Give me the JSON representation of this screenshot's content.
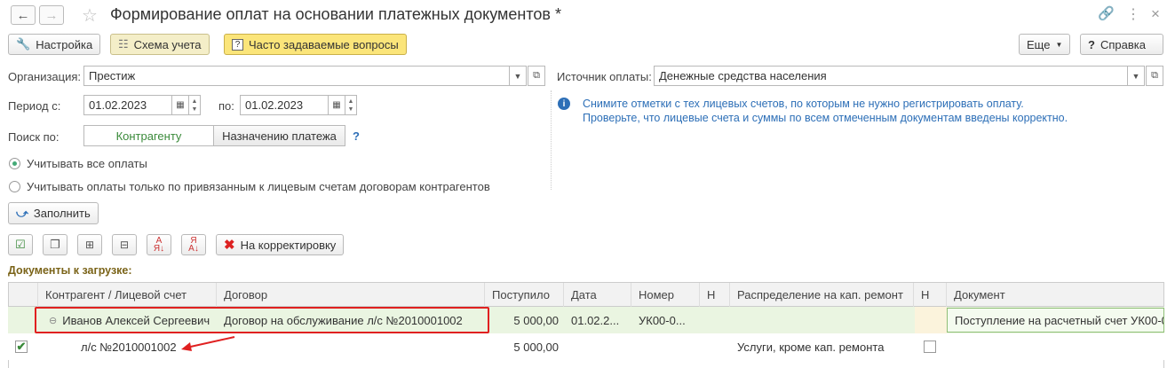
{
  "window": {
    "title": "Формирование оплат на основании платежных документов *"
  },
  "toolbar": {
    "settings_label": "Настройка",
    "scheme_label": "Схема учета",
    "faq_label": "Часто задаваемые вопросы",
    "more_label": "Еще",
    "help_label": "Справка"
  },
  "form": {
    "org_label": "Организация:",
    "org_value": "Престиж",
    "source_label": "Источник оплаты:",
    "source_value": "Денежные средства населения",
    "period_label": "Период с:",
    "period_from": "01.02.2023",
    "period_to_label": "по:",
    "period_to": "01.02.2023",
    "search_label": "Поиск по:",
    "search_opt1": "Контрагенту",
    "search_opt2": "Назначению платежа",
    "search_help": "?",
    "radio1": "Учитывать все оплаты",
    "radio2": "Учитывать оплаты только по привязанным к лицевым счетам договорам контрагентов",
    "fill_label": "Заполнить",
    "info_line1": "Снимите отметки с тех лицевых счетов, по которым не нужно регистрировать оплату.",
    "info_line2": "Проверьте, что лицевые счета и суммы по всем отмеченным документам введены корректно.",
    "correction_label": "На корректировку",
    "docs_label": "Документы к загрузке:"
  },
  "table": {
    "headers": [
      "Контрагент / Лицевой счет",
      "Договор",
      "Поступило",
      "Дата",
      "Номер",
      "Н",
      "Распределение на кап. ремонт",
      "Н",
      "Документ"
    ],
    "rows": [
      {
        "counterparty": "Иванов Алексей Сергеевич",
        "contract": "Договор на обслуживание л/с №2010001002",
        "amount": "5 000,00",
        "date": "01.02.2...",
        "number": "УК00-0...",
        "distribution": "",
        "document": "Поступление на расчетный счет УК00-0"
      },
      {
        "counterparty": "л/с №2010001002",
        "contract": "",
        "amount": "5 000,00",
        "date": "",
        "number": "",
        "distribution": "Услуги, кроме кап. ремонта",
        "document": ""
      }
    ]
  },
  "colors": {
    "accent_yellow": "#fbe57a",
    "row_selected": "#eaf5e1",
    "highlight_red": "#e02020",
    "info_blue": "#2d6fb7",
    "green_text": "#3a8a3a"
  }
}
